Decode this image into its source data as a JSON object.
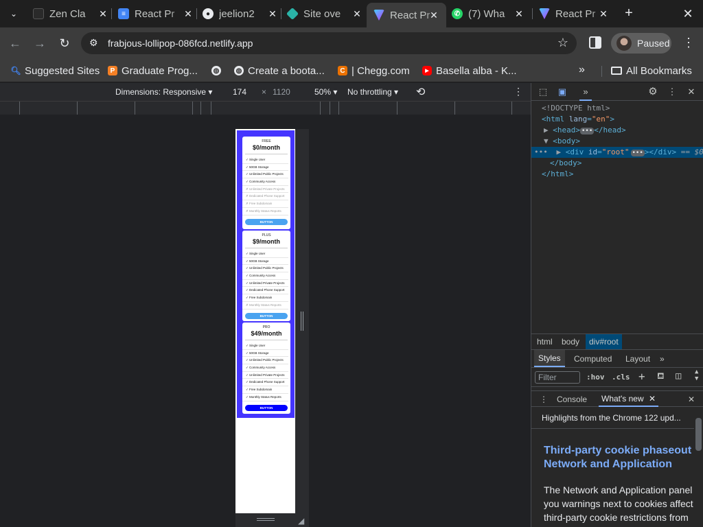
{
  "browser": {
    "tabs": [
      {
        "title": "Zen Cla",
        "favicon": "zen-icon",
        "color": "#2a2a2a"
      },
      {
        "title": "React Pr",
        "favicon": "docs-icon",
        "color": "#4285f4"
      },
      {
        "title": "jeelion2",
        "favicon": "github-icon",
        "color": "#1f1f1f"
      },
      {
        "title": "Site ove",
        "favicon": "netlify-icon",
        "color": "#2ab3a7"
      },
      {
        "title": "React Pr",
        "favicon": "vite-icon",
        "color": "#a259ff",
        "active": true
      },
      {
        "title": "(7) Wha",
        "favicon": "whatsapp-icon",
        "color": "#25d366"
      },
      {
        "title": "React Pr",
        "favicon": "vite-icon",
        "color": "#a259ff"
      }
    ],
    "url": "frabjous-lollipop-086fcd.netlify.app",
    "profile_label": "Paused",
    "bookmarks": [
      {
        "label": "Suggested Sites",
        "icon": "suggested-icon",
        "color": "#4285f4"
      },
      {
        "label": "Graduate Prog...",
        "icon": "princeton-icon",
        "color": "#f58025"
      },
      {
        "label": "",
        "icon": "globe-icon",
        "color": "#9aa0a6"
      },
      {
        "label": "Create a boota...",
        "icon": "globe-icon",
        "color": "#9aa0a6"
      },
      {
        "label": "| Chegg.com",
        "icon": "chegg-icon",
        "color": "#eb7100"
      },
      {
        "label": "Basella alba - K...",
        "icon": "youtube-icon",
        "color": "#ff0000"
      }
    ],
    "all_bookmarks_label": "All Bookmarks"
  },
  "device_toolbar": {
    "dimensions_label": "Dimensions: Responsive",
    "width": "174",
    "times": "×",
    "height": "1120",
    "zoom": "50%",
    "throttling": "No throttling"
  },
  "pricing": {
    "cards": [
      {
        "tier": "FREE",
        "price": "$0/month",
        "button": "BUTTON",
        "button_color": "#4aa3f0",
        "features": [
          {
            "text": "✓ Single User",
            "enabled": true
          },
          {
            "text": "✓ 50GB Storage",
            "enabled": true
          },
          {
            "text": "✓ Unlimited Public Projects",
            "enabled": true
          },
          {
            "text": "✓ Community Access",
            "enabled": true
          },
          {
            "text": "✗ Unlimited Private Projects",
            "enabled": false
          },
          {
            "text": "✗ Dedicated Phone Support",
            "enabled": false
          },
          {
            "text": "✗ Free Subdomain",
            "enabled": false
          },
          {
            "text": "✗ Monthly Status Reports",
            "enabled": false
          }
        ]
      },
      {
        "tier": "PLUS",
        "price": "$9/month",
        "button": "BUTTON",
        "button_color": "#4aa3f0",
        "features": [
          {
            "text": "✓ Single User",
            "enabled": true
          },
          {
            "text": "✓ 50GB Storage",
            "enabled": true
          },
          {
            "text": "✓ Unlimited Public Projects",
            "enabled": true
          },
          {
            "text": "✓ Community Access",
            "enabled": true
          },
          {
            "text": "✓ Unlimited Private Projects",
            "enabled": true
          },
          {
            "text": "✓ Dedicated Phone Support",
            "enabled": true
          },
          {
            "text": "✓ Free Subdomain",
            "enabled": true
          },
          {
            "text": "✗ Monthly Status Reports",
            "enabled": false
          }
        ]
      },
      {
        "tier": "PRO",
        "price": "$49/month",
        "button": "BUTTON",
        "button_color": "#0000ff",
        "features": [
          {
            "text": "✓ Single User",
            "enabled": true
          },
          {
            "text": "✓ 50GB Storage",
            "enabled": true
          },
          {
            "text": "✓ Unlimited Public Projects",
            "enabled": true
          },
          {
            "text": "✓ Community Access",
            "enabled": true
          },
          {
            "text": "✓ Unlimited Private Projects",
            "enabled": true
          },
          {
            "text": "✓ Dedicated Phone Support",
            "enabled": true
          },
          {
            "text": "✓ Free Subdomain",
            "enabled": true
          },
          {
            "text": "✓ Monthly Status Reports",
            "enabled": true
          }
        ]
      }
    ]
  },
  "devtools": {
    "dom": {
      "doctype": "<!DOCTYPE html>",
      "html_open_tag": "<html",
      "html_lang_attr": "lang",
      "html_lang_val": "\"en\"",
      "html_close_bracket": ">",
      "head_open": "<head>",
      "head_close": "</head>",
      "body_open": "<body>",
      "div_open": "<div",
      "div_attr": "id",
      "div_val": "\"root\"",
      "div_close": "></div>",
      "div_marker": "== $0",
      "body_close": "</body>",
      "html_close": "</html>"
    },
    "breadcrumbs": [
      "html",
      "body",
      "div#root"
    ],
    "style_tabs": [
      "Styles",
      "Computed",
      "Layout"
    ],
    "filter_placeholder": "Filter",
    "hov": ":hov",
    "cls": ".cls",
    "drawer_tabs": [
      "Console",
      "What's new"
    ],
    "whats_new": {
      "highlights": "Highlights from the Chrome 122 upd...",
      "title": "Third-party cookie phaseout in Network and Application",
      "text": "The Network and Application panel you warnings next to cookies affect third-party cookie restrictions from"
    }
  }
}
